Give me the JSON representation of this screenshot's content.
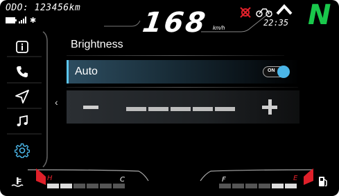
{
  "status": {
    "odometer": "ODO: 123456km",
    "speed": "168",
    "speed_unit": "km/h",
    "clock": "22:35",
    "gear": "N",
    "bluetooth_symbol": "✱"
  },
  "sidebar": {
    "items": [
      {
        "icon": "info-icon"
      },
      {
        "icon": "phone-icon"
      },
      {
        "icon": "navigation-icon"
      },
      {
        "icon": "music-icon"
      },
      {
        "icon": "settings-icon",
        "active": true
      }
    ]
  },
  "main": {
    "title": "Brightness",
    "back_chevron": "‹",
    "auto": {
      "label": "Auto",
      "toggle_text": "ON",
      "enabled": true
    },
    "slider": {
      "level_segments": 5
    }
  },
  "gauges": {
    "temp": {
      "hot_label": "H",
      "cold_label": "C"
    },
    "fuel": {
      "full_label": "F",
      "empty_label": "E"
    }
  },
  "colors": {
    "accent": "#4bb6e8",
    "gear": "#19c84b",
    "warning": "#e0202a"
  }
}
